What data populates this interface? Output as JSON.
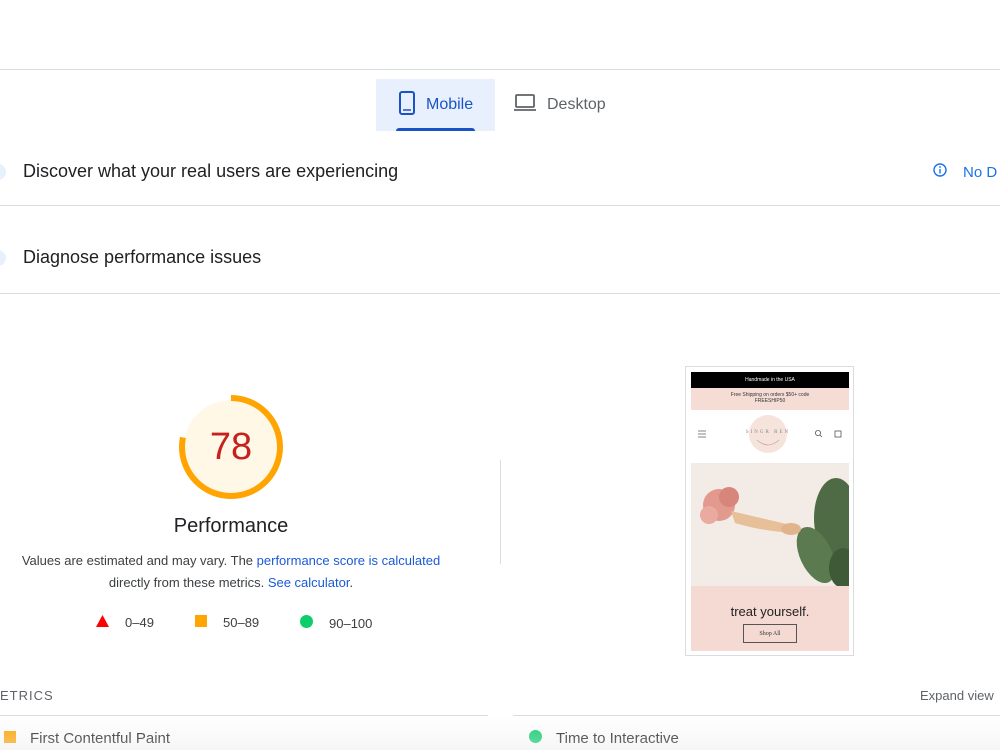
{
  "tabs": {
    "mobile_label": "Mobile",
    "desktop_label": "Desktop",
    "active": "mobile"
  },
  "sections": {
    "real_users_title": "Discover what your real users are experiencing",
    "no_data_label": "No D",
    "diagnose_title": "Diagnose performance issues"
  },
  "score": {
    "value": "78",
    "fraction": 0.78,
    "title": "Performance",
    "desc_prefix": "Values are estimated and may vary. The ",
    "desc_link1": "performance score is calculated",
    "desc_mid": "directly from these metrics. ",
    "desc_link2": "See calculator",
    "desc_suffix": "."
  },
  "legend": {
    "fail": "0–49",
    "average": "50–89",
    "pass": "90–100"
  },
  "preview": {
    "top_bar": "Handmade in the USA",
    "shipping_line1": "Free Shipping on orders $50+ code",
    "shipping_line2": "FREESHIP50",
    "logo_text": "SINGR REN",
    "tagline": "treat yourself.",
    "button": "Shop All"
  },
  "metrics": {
    "heading": "ETRICS",
    "expand_label": "Expand view",
    "items": [
      {
        "label": "First Contentful Paint",
        "status": "average"
      },
      {
        "label": "Time to Interactive",
        "status": "pass"
      }
    ]
  },
  "colors": {
    "accent": "#1a54c4",
    "fail": "#ff0000",
    "average": "#ffa400",
    "pass": "#0cce6b",
    "score_text": "#c5221f",
    "score_bg": "#fff8e6"
  }
}
